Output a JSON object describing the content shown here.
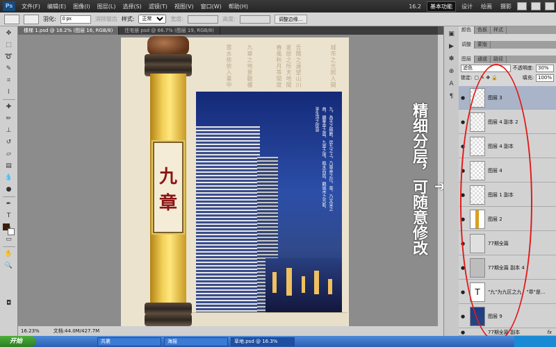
{
  "app": {
    "logo": "Ps",
    "menus": [
      "文件(F)",
      "编辑(E)",
      "图像(I)",
      "图层(L)",
      "选择(S)",
      "滤镜(T)",
      "视图(V)",
      "窗口(W)",
      "帮助(H)"
    ],
    "zoom_level": "16.2",
    "workspaces": [
      "基本功能",
      "设计",
      "绘画",
      "摄影"
    ]
  },
  "options": {
    "feather_label": "羽化:",
    "feather_value": "0 px",
    "antialias_label": "消除锯齿",
    "style_label": "样式:",
    "style_value": "正常",
    "width_label": "宽度:",
    "height_label": "高度:",
    "refine_button": "调整边缘..."
  },
  "tabs": [
    {
      "label": "楼梯 1.psd @ 16.2% (图层 16, RGB/8)"
    },
    {
      "label": "住宅册 psd @ 66.7% (图层 19, RGB/8)"
    }
  ],
  "status": {
    "zoom": "16.23%",
    "doc_info": "文档:44.0M/427.7M"
  },
  "annotation": {
    "text": "精细分层，可随意修改",
    "arrow": "➔"
  },
  "document": {
    "title_glyphs": [
      "九",
      "章"
    ],
    "calligraphy_cols": [
      "吾聞之遠望山川",
      "家居之所天地間",
      "春風秋月等閒度",
      "九章之地景觀樓",
      "雲水依依入畫中",
      "城市之光照人間"
    ],
    "photo_text": "九，為天之極數，居九之上，乃尊崇之位。章，乃文采之典，顯華章之盛。九章之地，臨水而居，觀城市之光影，享生活之從容"
  },
  "panels": {
    "top_tabs": [
      "颜色",
      "色板",
      "样式"
    ],
    "second_tabs": [
      "调整",
      "蒙版"
    ],
    "layer_tabs": [
      "图层",
      "通道",
      "路径"
    ],
    "blend_mode": "滤色",
    "opacity_label": "不透明度:",
    "opacity_value": "30%",
    "lock_label": "锁定:",
    "fill_label": "填充:",
    "fill_value": "100%"
  },
  "layers": [
    {
      "name": "图层 3",
      "visible": true,
      "selected": true,
      "fx": ""
    },
    {
      "name": "图层 4 副本 2",
      "visible": true,
      "selected": false,
      "fx": ""
    },
    {
      "name": "图层 4 副本",
      "visible": true,
      "selected": false,
      "fx": ""
    },
    {
      "name": "图层 4",
      "visible": true,
      "selected": false,
      "fx": ""
    },
    {
      "name": "图层 1 副本",
      "visible": true,
      "selected": false,
      "fx": ""
    },
    {
      "name": "图层 2",
      "visible": true,
      "selected": false,
      "fx": ""
    },
    {
      "name": "77期全篇",
      "visible": true,
      "selected": false,
      "fx": ""
    },
    {
      "name": "77期全篇 副本 4",
      "visible": true,
      "selected": false,
      "fx": ""
    },
    {
      "name": "\"九\"为九区之九，\"章\"是...",
      "visible": true,
      "selected": false,
      "fx": ""
    },
    {
      "name": "图层 9",
      "visible": true,
      "selected": false,
      "fx": ""
    },
    {
      "name": "77期全篇 副本",
      "visible": true,
      "selected": false,
      "fx": "fx"
    }
  ],
  "taskbar": {
    "start": "开始",
    "tasks": [
      "共裹",
      "海报",
      "草地.psd @ 16.3%"
    ]
  },
  "colors": {
    "accent_red": "#e21a1a",
    "selected_layer": "#a9b4c8"
  }
}
